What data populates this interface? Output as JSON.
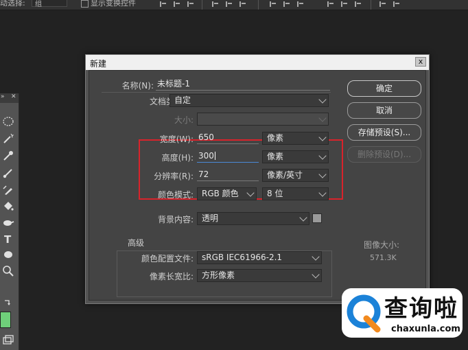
{
  "topbar": {
    "auto_select_label": "动选择:",
    "auto_select_value": "组",
    "show_transform_label": "显示变换控件"
  },
  "dialog": {
    "title": "新建",
    "close_label": "x",
    "name_label": "名称(N):",
    "name_value": "未标题-1",
    "doc_type_label": "文档类型:",
    "doc_type_value": "自定",
    "size_label": "大小:",
    "size_value": "",
    "width_label": "宽度(W):",
    "width_value": "650",
    "width_unit": "像素",
    "height_label": "高度(H):",
    "height_value": "300",
    "height_unit": "像素",
    "resolution_label": "分辨率(R):",
    "resolution_value": "72",
    "resolution_unit": "像素/英寸",
    "color_mode_label": "颜色模式:",
    "color_mode_value": "RGB 颜色",
    "bit_depth_value": "8 位",
    "background_label": "背景内容:",
    "background_value": "透明",
    "advanced_label": "高级",
    "color_profile_label": "颜色配置文件:",
    "color_profile_value": "sRGB IEC61966-2.1",
    "pixel_aspect_label": "像素长宽比:",
    "pixel_aspect_value": "方形像素",
    "buttons": {
      "ok": "确定",
      "cancel": "取消",
      "save_preset": "存储预设(S)...",
      "delete_preset": "删除预设(D)..."
    },
    "image_size_label": "图像大小:",
    "image_size_value": "571.3K"
  },
  "watermark": {
    "text": "查询啦",
    "url": "chaxunla.com"
  },
  "colors": {
    "highlight_box": "#d9232b",
    "foreground_swatch": "#6fcf7a"
  }
}
